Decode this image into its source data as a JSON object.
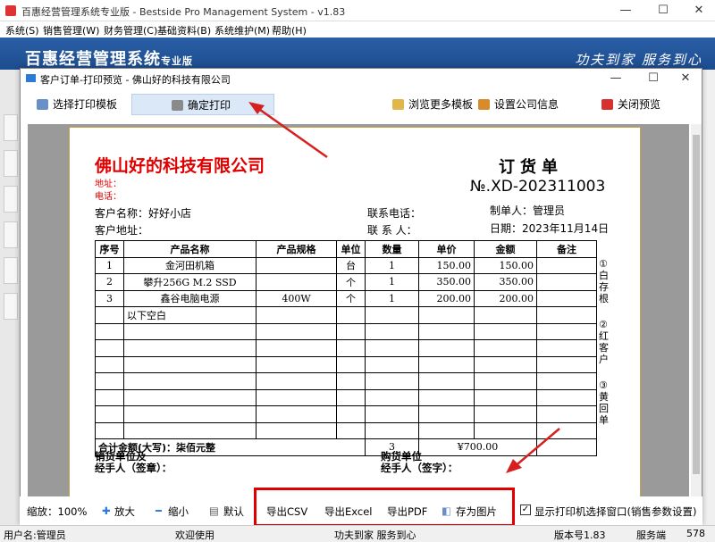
{
  "app": {
    "title": "百惠经营管理系统专业版 - Bestside Pro Management System - v1.83",
    "menu": [
      "系统(S)",
      "销售管理(W)",
      "财务管理(C)",
      "基础资料(B)",
      "系统维护(M)",
      "帮助(H)"
    ],
    "brand": "百惠经营管理系统",
    "brand_suffix": "专业版",
    "slogan": "功夫到家 服务到心"
  },
  "dialog": {
    "title": "客户订单-打印预览 - 佛山好的科技有限公司",
    "toolbar": {
      "select_template": "选择打印模板",
      "confirm_print": "确定打印",
      "browse_templates": "浏览更多模板",
      "company_info": "设置公司信息",
      "close_preview": "关闭预览"
    }
  },
  "document": {
    "company": "佛山好的科技有限公司",
    "address_label": "地址：",
    "phone_label": "电话：",
    "doc_title": "订货单",
    "doc_number": "№.XD-202311003",
    "customer_name": "客户名称：好好小店",
    "customer_address": "客户地址：",
    "contact_phone": "联系电话：",
    "contact_person": "联 系 人：",
    "maker": "制单人：管理员",
    "date": "日期：2023年11月14日",
    "headers": [
      "序号",
      "产品名称",
      "产品规格",
      "单位",
      "数量",
      "单价",
      "金额",
      "备注"
    ],
    "rows": [
      [
        "1",
        "金河田机箱",
        "",
        "台",
        "1",
        "150.00",
        "150.00",
        ""
      ],
      [
        "2",
        "攀升256G M.2 SSD",
        "",
        "个",
        "1",
        "350.00",
        "350.00",
        ""
      ],
      [
        "3",
        "鑫谷电脑电源",
        "400W",
        "个",
        "1",
        "200.00",
        "200.00",
        ""
      ]
    ],
    "blank_note": "以下空白",
    "total_label": "合计金额(大写)：柒佰元整",
    "total_qty": "3",
    "total_amount": "¥700.00",
    "seller_line1": "销货单位及",
    "seller_line2": "经手人（签章）：",
    "buyer_line1": "购货单位",
    "buyer_line2": "经手人（签字）：",
    "side_notes": [
      "①白存根",
      "②红客户",
      "③黄回单"
    ]
  },
  "footer": {
    "zoom": "缩放：100%",
    "zoom_in": "放大",
    "zoom_out": "缩小",
    "default": "默认",
    "export_csv": "导出CSV",
    "export_excel": "导出Excel",
    "export_pdf": "导出PDF",
    "save_image": "存为图片",
    "show_printer": "显示打印机选择窗口(销售参数设置)"
  },
  "status": {
    "user": "用户名:管理员",
    "welcome": "欢迎使用",
    "slogan": "功夫到家 服务到心",
    "version": "版本号1.83",
    "side": "服务端",
    "extra": "578"
  }
}
